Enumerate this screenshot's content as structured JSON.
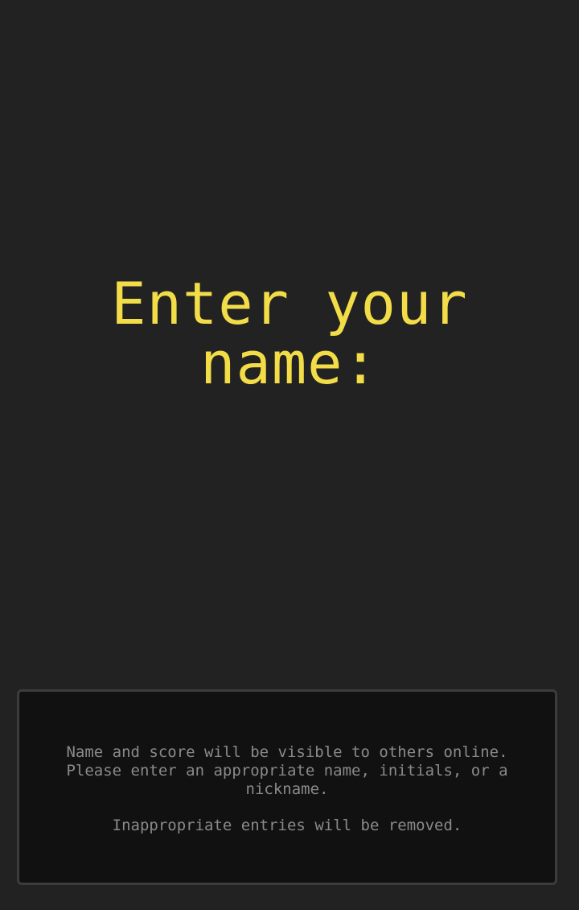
{
  "prompt": {
    "line1": "Enter your",
    "line2": "name:"
  },
  "notice": {
    "message": "Name and score will be visible to others online. Please enter an appropriate name, initials, or a nickname.",
    "warning": "Inappropriate entries will be removed."
  },
  "colors": {
    "background": "#222222",
    "prompt_text": "#f2dc48",
    "notice_background": "#111111",
    "notice_border": "#3c3c3c",
    "notice_text": "#8a8a8a"
  }
}
